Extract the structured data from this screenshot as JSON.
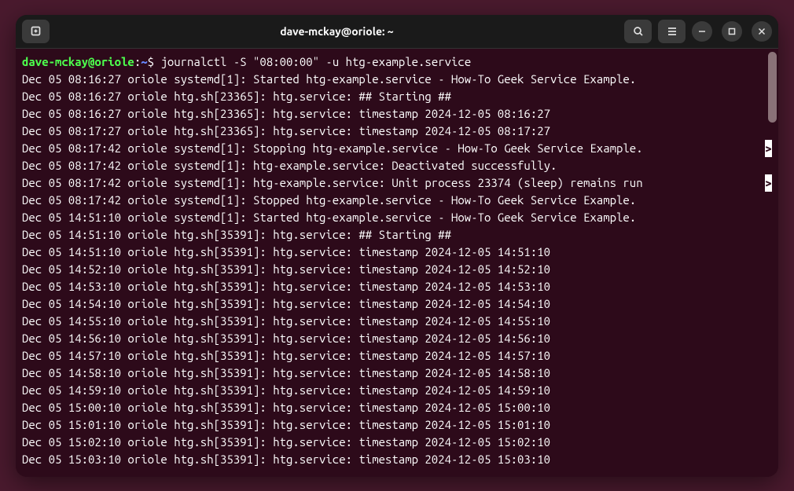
{
  "titlebar": {
    "title": "dave-mckay@oriole: ~"
  },
  "prompt": {
    "user_host": "dave-mckay@oriole",
    "colon": ":",
    "path": "~",
    "dollar": "$",
    "command": " journalctl -S \"08:00:00\" -u htg-example.service"
  },
  "log_lines": [
    {
      "text": "Dec 05 08:16:27 oriole systemd[1]: Started htg-example.service - How-To Geek Service Example."
    },
    {
      "text": "Dec 05 08:16:27 oriole htg.sh[23365]: htg.service: ## Starting ##"
    },
    {
      "text": "Dec 05 08:16:27 oriole htg.sh[23365]: htg.service: timestamp 2024-12-05 08:16:27"
    },
    {
      "text": "Dec 05 08:17:27 oriole htg.sh[23365]: htg.service: timestamp 2024-12-05 08:17:27"
    },
    {
      "text": "Dec 05 08:17:42 oriole systemd[1]: Stopping htg-example.service - How-To Geek Service Example.",
      "trunc": ">"
    },
    {
      "text": "Dec 05 08:17:42 oriole systemd[1]: htg-example.service: Deactivated successfully."
    },
    {
      "text": "Dec 05 08:17:42 oriole systemd[1]: htg-example.service: Unit process 23374 (sleep) remains run",
      "trunc": ">"
    },
    {
      "text": "Dec 05 08:17:42 oriole systemd[1]: Stopped htg-example.service - How-To Geek Service Example."
    },
    {
      "text": "Dec 05 14:51:10 oriole systemd[1]: Started htg-example.service - How-To Geek Service Example."
    },
    {
      "text": "Dec 05 14:51:10 oriole htg.sh[35391]: htg.service: ## Starting ##"
    },
    {
      "text": "Dec 05 14:51:10 oriole htg.sh[35391]: htg.service: timestamp 2024-12-05 14:51:10"
    },
    {
      "text": "Dec 05 14:52:10 oriole htg.sh[35391]: htg.service: timestamp 2024-12-05 14:52:10"
    },
    {
      "text": "Dec 05 14:53:10 oriole htg.sh[35391]: htg.service: timestamp 2024-12-05 14:53:10"
    },
    {
      "text": "Dec 05 14:54:10 oriole htg.sh[35391]: htg.service: timestamp 2024-12-05 14:54:10"
    },
    {
      "text": "Dec 05 14:55:10 oriole htg.sh[35391]: htg.service: timestamp 2024-12-05 14:55:10"
    },
    {
      "text": "Dec 05 14:56:10 oriole htg.sh[35391]: htg.service: timestamp 2024-12-05 14:56:10"
    },
    {
      "text": "Dec 05 14:57:10 oriole htg.sh[35391]: htg.service: timestamp 2024-12-05 14:57:10"
    },
    {
      "text": "Dec 05 14:58:10 oriole htg.sh[35391]: htg.service: timestamp 2024-12-05 14:58:10"
    },
    {
      "text": "Dec 05 14:59:10 oriole htg.sh[35391]: htg.service: timestamp 2024-12-05 14:59:10"
    },
    {
      "text": "Dec 05 15:00:10 oriole htg.sh[35391]: htg.service: timestamp 2024-12-05 15:00:10"
    },
    {
      "text": "Dec 05 15:01:10 oriole htg.sh[35391]: htg.service: timestamp 2024-12-05 15:01:10"
    },
    {
      "text": "Dec 05 15:02:10 oriole htg.sh[35391]: htg.service: timestamp 2024-12-05 15:02:10"
    },
    {
      "text": "Dec 05 15:03:10 oriole htg.sh[35391]: htg.service: timestamp 2024-12-05 15:03:10"
    }
  ]
}
